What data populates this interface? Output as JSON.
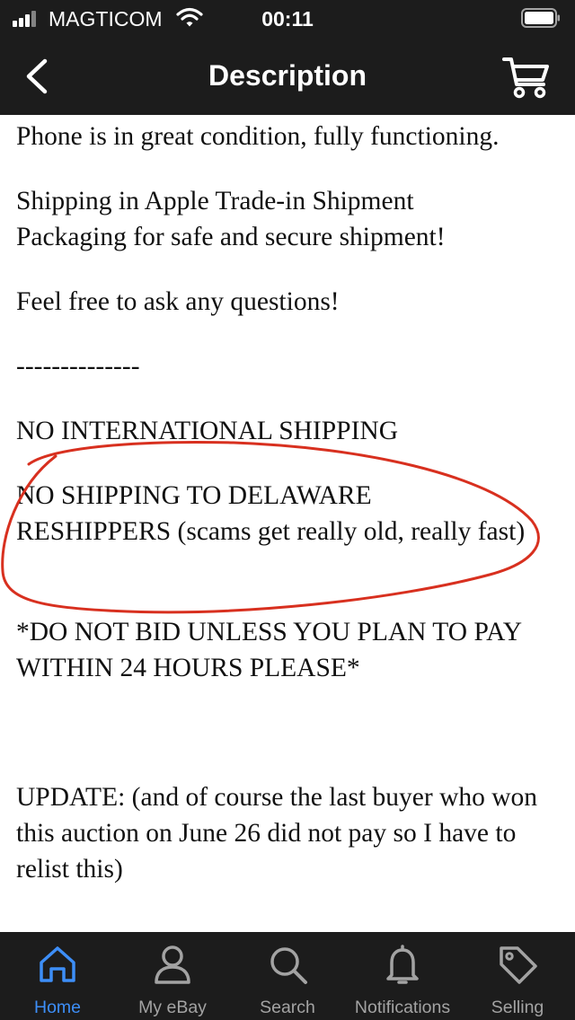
{
  "status_bar": {
    "carrier": "MAGTICOM",
    "time": "00:11"
  },
  "header": {
    "title": "Description",
    "back_icon": "chevron-left-icon",
    "cart_icon": "cart-icon"
  },
  "description": {
    "paragraphs": [
      "Phone is in great condition, fully functioning.",
      "Shipping in Apple Trade-in Shipment Packaging for safe and secure shipment!",
      "Feel free to ask any questions!",
      "--------------",
      "NO INTERNATIONAL SHIPPING",
      "NO SHIPPING TO DELAWARE RESHIPPERS (scams get really old, really fast)",
      "*DO NOT BID UNLESS YOU PLAN TO PAY WITHIN 24 HOURS PLEASE*",
      "UPDATE: (and of course the last buyer who won this auction on June 26 did not pay so I have to relist this)"
    ]
  },
  "annotation": {
    "color": "#d8301f"
  },
  "tabbar": {
    "active_color": "#3d8ef7",
    "inactive_color": "#a3a3a3",
    "tabs": [
      {
        "label": "Home",
        "icon": "home-icon"
      },
      {
        "label": "My eBay",
        "icon": "person-icon"
      },
      {
        "label": "Search",
        "icon": "search-icon"
      },
      {
        "label": "Notifications",
        "icon": "bell-icon"
      },
      {
        "label": "Selling",
        "icon": "tag-icon"
      }
    ]
  }
}
